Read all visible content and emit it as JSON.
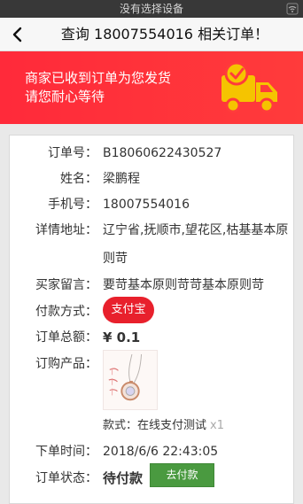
{
  "device_bar": {
    "label": "没有选择设备"
  },
  "nav": {
    "title": "查询 18007554016 相关订单！"
  },
  "banner": {
    "line1": "商家已收到订单为您发货",
    "line2": "请您耐心等待"
  },
  "order": {
    "order_no_label": "订单号：",
    "order_no": "B18060622430527",
    "name_label": "姓名：",
    "name": "梁鹏程",
    "phone_label": "手机号：",
    "phone": "18007554016",
    "address_label": "详情地址：",
    "address": "辽宁省,抚顺市,望花区,枯基基本原则苛",
    "remark_label": "买家留言：",
    "remark": "要苛基本原则苛苛基本原则苛",
    "payment_label": "付款方式：",
    "payment": "支付宝",
    "total_label": "订单总额：",
    "total": "¥ 0.1",
    "product_label": "订购产品：",
    "style_label": "款式：在线支付测试",
    "quantity": "x1",
    "time_label": "下单时间：",
    "time": "2018/6/6 22:43:05",
    "status_label": "订单状态：",
    "status": "待付款",
    "pay_button": "去付款"
  },
  "colors": {
    "accent_red": "#e8202c",
    "banner_red": "#ff3b3b",
    "pay_green": "#4a9a40",
    "truck_yellow": "#f5c400"
  },
  "icons": {
    "back": "chevron-left-icon",
    "wifi": "wifi-icon",
    "truck": "delivery-truck-icon"
  }
}
